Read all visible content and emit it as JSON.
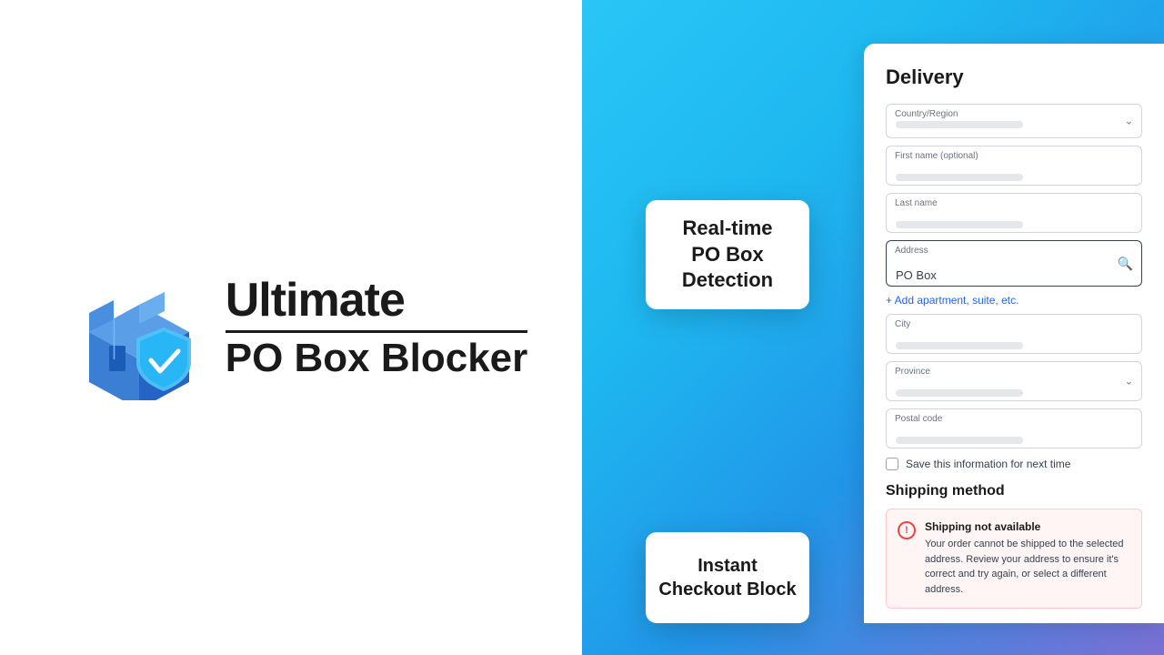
{
  "brand": {
    "title": "Ultimate",
    "subtitle": "PO Box Blocker"
  },
  "cards": {
    "realtime": {
      "line1": "Real-time",
      "line2": "PO Box",
      "line3": "Detection"
    },
    "instant": {
      "line1": "Instant",
      "line2": "Checkout Block"
    }
  },
  "form": {
    "delivery_title": "Delivery",
    "fields": {
      "country_label": "Country/Region",
      "firstname_label": "First name (optional)",
      "lastname_label": "Last name",
      "address_label": "Address",
      "address_value": "PO Box",
      "add_suite": "+ Add apartment, suite, etc.",
      "city_label": "City",
      "province_label": "Province",
      "postal_label": "Postal code",
      "save_label": "Save this information for next time"
    },
    "shipping_method_title": "Shipping method",
    "error": {
      "title": "Shipping not available",
      "description": "Your order cannot be shipped to the selected address. Review your address to ensure it's correct and try again, or select a different address."
    }
  },
  "colors": {
    "accent_blue": "#2563eb",
    "error_red": "#ef4444",
    "gradient_start": "#29c6f7",
    "gradient_end": "#7b6fd4"
  }
}
